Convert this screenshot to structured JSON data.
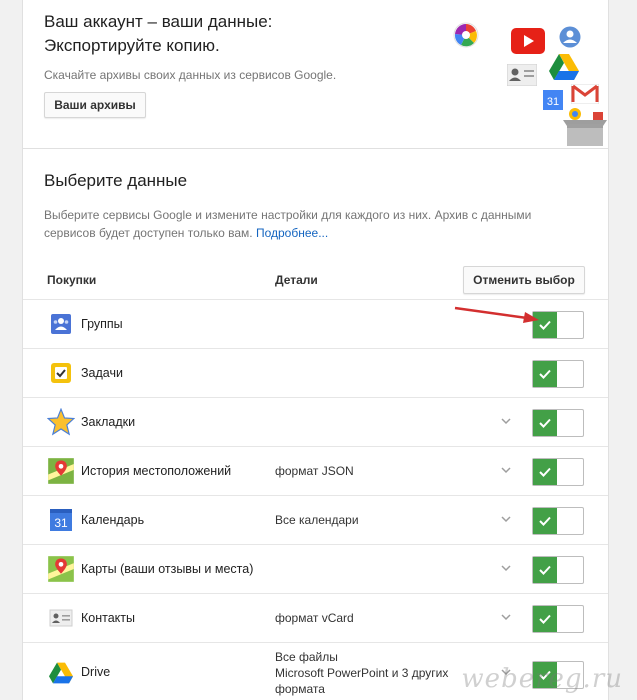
{
  "header": {
    "title_line1": "Ваш аккаунт – ваши данные:",
    "title_line2": "Экспортируйте копию.",
    "subtitle": "Скачайте архивы своих данных из сервисов Google.",
    "archives_button": "Ваши архивы"
  },
  "illustration": {
    "icons": [
      "picasa-icon",
      "youtube-icon",
      "profile-icon",
      "contacts-card-icon",
      "drive-icon",
      "calendar-icon",
      "gmail-icon",
      "archive-box-icon"
    ],
    "calendar_number": "31"
  },
  "section": {
    "title": "Выберите данные",
    "description": "Выберите сервисы Google и измените настройки для каждого из них. Архив с данными сервисов будет доступен только вам.",
    "more_link": "Подробнее..."
  },
  "table": {
    "col_products": "Покупки",
    "col_details": "Детали",
    "deselect_button": "Отменить выбор",
    "rows": [
      {
        "name": "Группы",
        "detail": "",
        "icon": "groups-icon",
        "dropdown": false,
        "enabled": true
      },
      {
        "name": "Задачи",
        "detail": "",
        "icon": "tasks-icon",
        "dropdown": false,
        "enabled": true
      },
      {
        "name": "Закладки",
        "detail": "",
        "icon": "bookmarks-star-icon",
        "dropdown": true,
        "enabled": true
      },
      {
        "name": "История местоположений",
        "detail": "формат JSON",
        "icon": "location-history-icon",
        "dropdown": true,
        "enabled": true
      },
      {
        "name": "Календарь",
        "detail": "Все календари",
        "icon": "calendar-icon",
        "dropdown": true,
        "enabled": true
      },
      {
        "name": "Карты (ваши отзывы и места)",
        "detail": "",
        "icon": "maps-icon",
        "dropdown": true,
        "enabled": true
      },
      {
        "name": "Контакты",
        "detail": "формат vCard",
        "icon": "contacts-icon",
        "dropdown": true,
        "enabled": true
      },
      {
        "name": "Drive",
        "detail_lines": [
          "Все файлы",
          "Microsoft PowerPoint и 3 других",
          "формата"
        ],
        "icon": "drive-icon",
        "dropdown": true,
        "enabled": true
      }
    ]
  },
  "colors": {
    "toggle_on": "#43a047",
    "link": "#1565c0",
    "arrow": "#d32f2f"
  },
  "watermark": "webereg.ru"
}
